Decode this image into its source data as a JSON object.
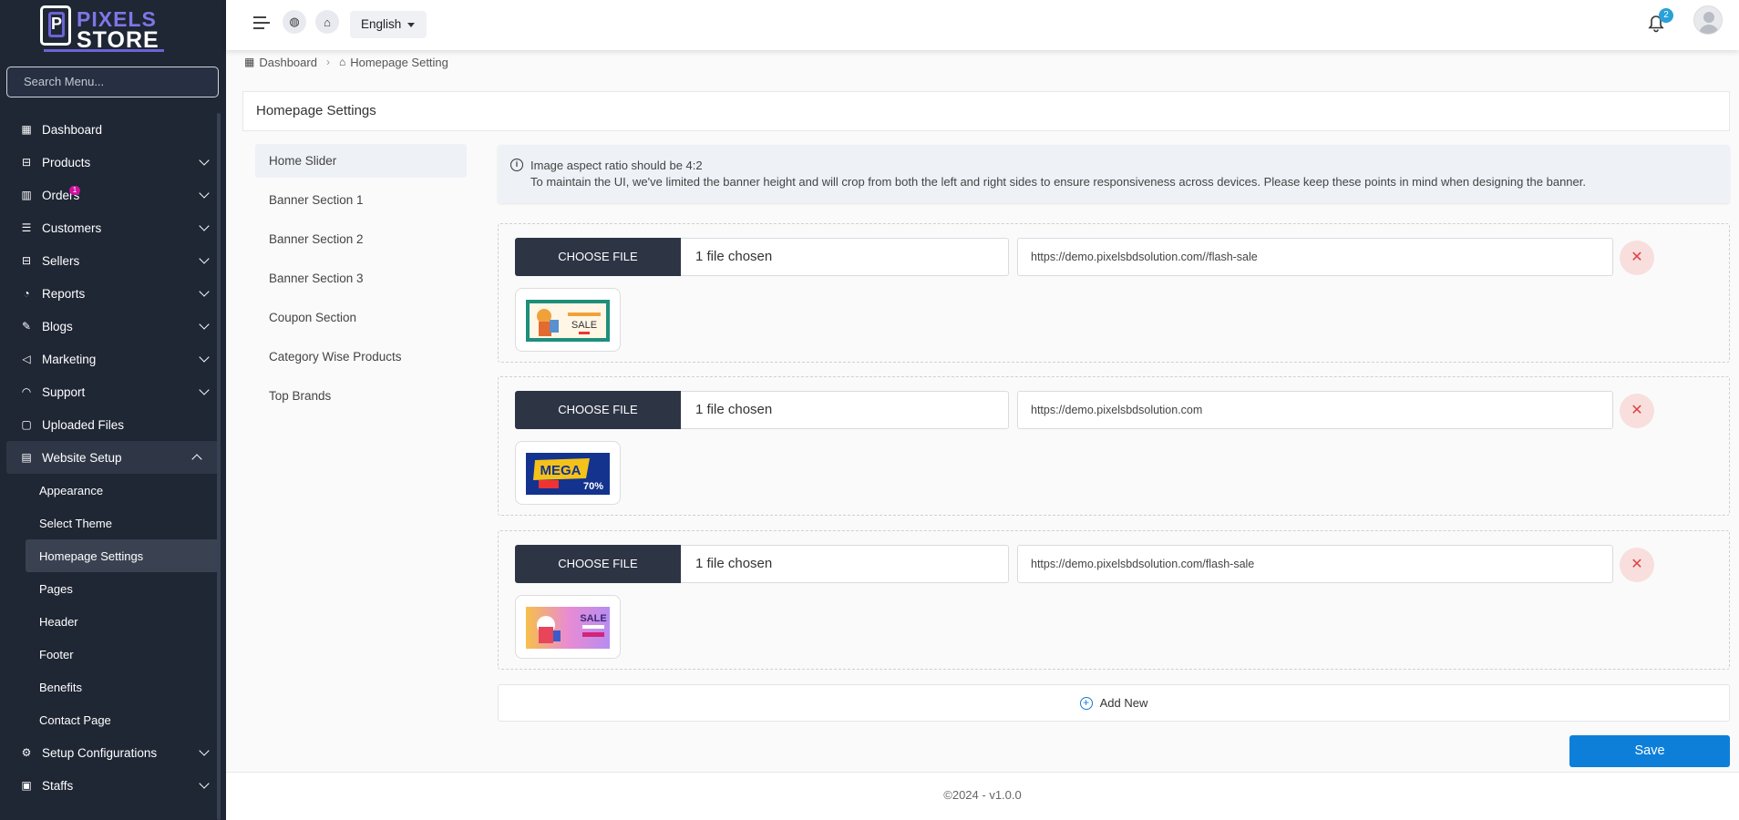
{
  "brand": {
    "line1": "PIXELS",
    "line2": "STORE",
    "logo_letter": "P"
  },
  "sidebar": {
    "search_placeholder": "Search Menu...",
    "items": [
      {
        "label": "Dashboard",
        "icon": "dashboard-icon",
        "glyph": "▦",
        "chevron": false
      },
      {
        "label": "Products",
        "icon": "box-icon",
        "glyph": "⊟",
        "chevron": true
      },
      {
        "label": "Orders",
        "icon": "chart-icon",
        "glyph": "▥",
        "chevron": true,
        "badge": "1"
      },
      {
        "label": "Customers",
        "icon": "users-icon",
        "glyph": "☰",
        "chevron": true
      },
      {
        "label": "Sellers",
        "icon": "store-icon",
        "glyph": "⊟",
        "chevron": true
      },
      {
        "label": "Reports",
        "icon": "pie-icon",
        "glyph": "◔",
        "chevron": true
      },
      {
        "label": "Blogs",
        "icon": "edit-icon",
        "glyph": "✎",
        "chevron": true
      },
      {
        "label": "Marketing",
        "icon": "megaphone-icon",
        "glyph": "◁",
        "chevron": true
      },
      {
        "label": "Support",
        "icon": "headset-icon",
        "glyph": "◠",
        "chevron": true
      },
      {
        "label": "Uploaded Files",
        "icon": "file-icon",
        "glyph": "▢",
        "chevron": false
      },
      {
        "label": "Website Setup",
        "icon": "monitor-icon",
        "glyph": "▤",
        "chevron": true,
        "expanded": true
      }
    ],
    "subitems": [
      "Appearance",
      "Select Theme",
      "Homepage Settings",
      "Pages",
      "Header",
      "Footer",
      "Benefits",
      "Contact Page"
    ],
    "bottom_items": [
      {
        "label": "Setup Configurations",
        "icon": "settings-icon",
        "glyph": "⚙",
        "chevron": true
      },
      {
        "label": "Staffs",
        "icon": "user-square-icon",
        "glyph": "▣",
        "chevron": true
      }
    ]
  },
  "topbar": {
    "language": "English",
    "notification_count": "2"
  },
  "breadcrumb": {
    "home": "Dashboard",
    "current": "Homepage Setting"
  },
  "page": {
    "title": "Homepage Settings",
    "tabs": [
      "Home Slider",
      "Banner Section 1",
      "Banner Section 2",
      "Banner Section 3",
      "Coupon Section",
      "Category Wise Products",
      "Top Brands"
    ],
    "info_line1": "Image aspect ratio should be 4:2",
    "info_line2": "To maintain the UI, we've limited the banner height and will crop from both the left and right sides to ensure responsiveness across devices. Please keep these points in mind when designing the banner.",
    "slides": [
      {
        "button": "CHOOSE FILE",
        "file_text": "1 file chosen",
        "url": "https://demo.pixelsbdsolution.com//flash-sale",
        "thumb_text": "SALE"
      },
      {
        "button": "CHOOSE FILE",
        "file_text": "1 file chosen",
        "url": "https://demo.pixelsbdsolution.com",
        "thumb_text": "MEGA"
      },
      {
        "button": "CHOOSE FILE",
        "file_text": "1 file chosen",
        "url": "https://demo.pixelsbdsolution.com/flash-sale",
        "thumb_text": "SALE"
      }
    ],
    "add_new": "Add New",
    "save": "Save"
  },
  "footer": {
    "text": "©2024 - v1.0.0"
  },
  "colors": {
    "sidebar_bg": "#1f2634",
    "primary": "#0d7fd8",
    "choose_btn": "#2d3444",
    "remove_bg": "#f9dede"
  }
}
